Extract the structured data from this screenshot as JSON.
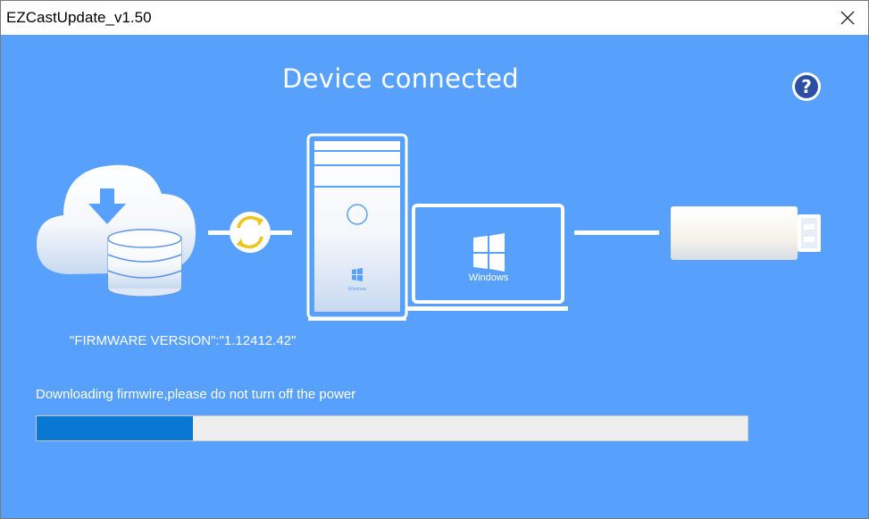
{
  "window": {
    "title": "EZCastUpdate_v1.50"
  },
  "main": {
    "heading": "Device connected",
    "firmware_version": "\"FIRMWARE VERSION\":\"1.12412.42\"",
    "status_message": "Downloading firmwire,please do not turn off the power",
    "progress": 0.22
  },
  "illustration": {
    "desktop_logo_text": "Windows",
    "laptop_logo_text": "Windows"
  },
  "icons": {
    "close": "close-icon",
    "help": "help-icon",
    "cloud": "cloud-download-icon",
    "database": "database-icon",
    "sync": "sync-icon",
    "desktop": "desktop-tower-icon",
    "laptop": "laptop-icon",
    "dongle": "usb-dongle-icon"
  },
  "colors": {
    "background": "#57a0fb",
    "progress_fill": "#0a78d2",
    "progress_track": "#eeeeee",
    "sync_arrows": "#f0c419"
  }
}
